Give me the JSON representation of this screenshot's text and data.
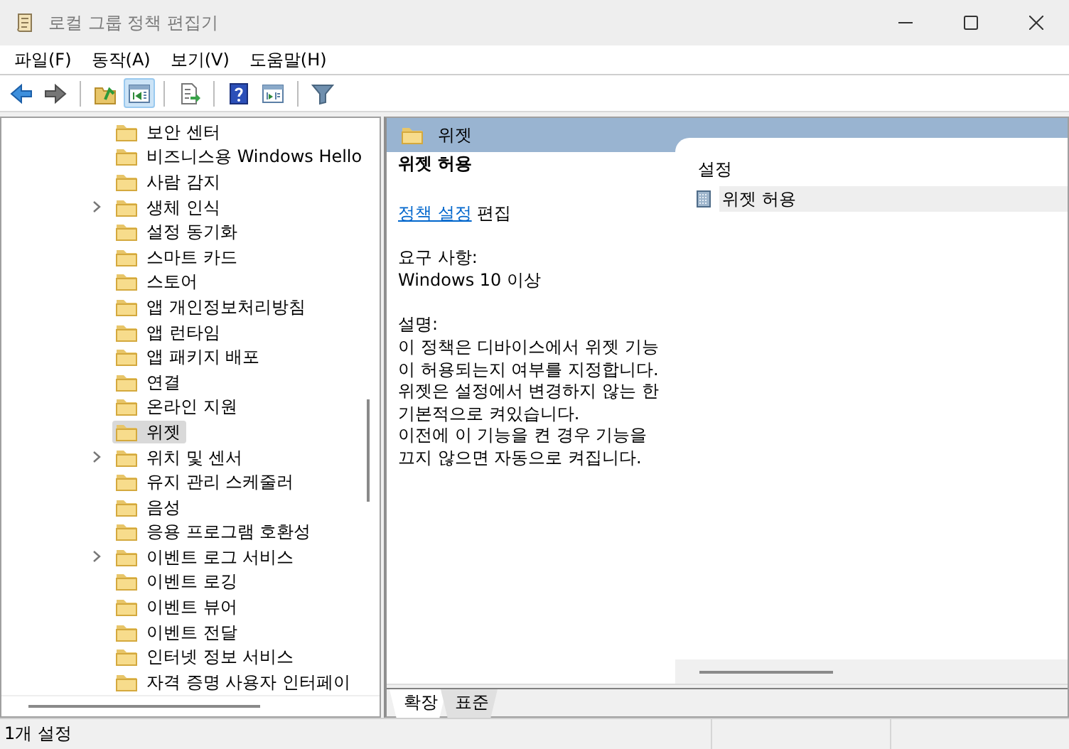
{
  "window": {
    "title": "로컬 그룹 정책 편집기"
  },
  "menu": [
    "파일(F)",
    "동작(A)",
    "보기(V)",
    "도움말(H)"
  ],
  "toolbar": [
    {
      "kind": "back",
      "disabled": false,
      "pressed": false
    },
    {
      "kind": "forward",
      "disabled": true,
      "pressed": false
    },
    {
      "kind": "separator"
    },
    {
      "kind": "up",
      "disabled": false,
      "pressed": false
    },
    {
      "kind": "tree",
      "disabled": false,
      "pressed": true
    },
    {
      "kind": "separator"
    },
    {
      "kind": "export",
      "disabled": false,
      "pressed": false
    },
    {
      "kind": "separator"
    },
    {
      "kind": "help",
      "disabled": false,
      "pressed": false
    },
    {
      "kind": "pane",
      "disabled": false,
      "pressed": false
    },
    {
      "kind": "separator"
    },
    {
      "kind": "filter",
      "disabled": false,
      "pressed": false
    }
  ],
  "tree": {
    "items": [
      {
        "label": "보안 센터",
        "expandable": false,
        "selected": false
      },
      {
        "label": "비즈니스용 Windows Hello",
        "expandable": false,
        "selected": false
      },
      {
        "label": "사람 감지",
        "expandable": false,
        "selected": false
      },
      {
        "label": "생체 인식",
        "expandable": true,
        "selected": false
      },
      {
        "label": "설정 동기화",
        "expandable": false,
        "selected": false
      },
      {
        "label": "스마트 카드",
        "expandable": false,
        "selected": false
      },
      {
        "label": "스토어",
        "expandable": false,
        "selected": false
      },
      {
        "label": "앱 개인정보처리방침",
        "expandable": false,
        "selected": false
      },
      {
        "label": "앱 런타임",
        "expandable": false,
        "selected": false
      },
      {
        "label": "앱 패키지 배포",
        "expandable": false,
        "selected": false
      },
      {
        "label": "연결",
        "expandable": false,
        "selected": false
      },
      {
        "label": "온라인 지원",
        "expandable": false,
        "selected": false
      },
      {
        "label": "위젯",
        "expandable": false,
        "selected": true
      },
      {
        "label": "위치 및 센서",
        "expandable": true,
        "selected": false
      },
      {
        "label": "유지 관리 스케줄러",
        "expandable": false,
        "selected": false
      },
      {
        "label": "음성",
        "expandable": false,
        "selected": false
      },
      {
        "label": "응용 프로그램 호환성",
        "expandable": false,
        "selected": false
      },
      {
        "label": "이벤트 로그 서비스",
        "expandable": true,
        "selected": false
      },
      {
        "label": "이벤트 로깅",
        "expandable": false,
        "selected": false
      },
      {
        "label": "이벤트 뷰어",
        "expandable": false,
        "selected": false
      },
      {
        "label": "이벤트 전달",
        "expandable": false,
        "selected": false
      },
      {
        "label": "인터넷 정보 서비스",
        "expandable": false,
        "selected": false
      },
      {
        "label": "자격 증명 사용자 인터페이",
        "expandable": false,
        "selected": false
      }
    ]
  },
  "detail": {
    "header": "위젯",
    "title": "위젯 허용",
    "link": "정책 설정",
    "link_suffix": "편집",
    "requirements_label": "요구 사항:",
    "requirements": "Windows 10 이상",
    "description_label": "설명:",
    "description": [
      "이 정책은 디바이스에서 위젯 기능이 허용되는지 여부를 지정합니다.",
      "위젯은 설정에서 변경하지 않는 한 기본적으로 켜있습니다.",
      "이전에 이 기능을 켠 경우 기능을 끄지 않으면 자동으로 켜집니다."
    ]
  },
  "settings": {
    "column": "설정",
    "rows": [
      {
        "label": "위젯 허용",
        "selected": true
      }
    ]
  },
  "tabs": [
    {
      "label": "확장",
      "selected": true
    },
    {
      "label": "표준",
      "selected": false
    }
  ],
  "status_bar": "1개 설정"
}
